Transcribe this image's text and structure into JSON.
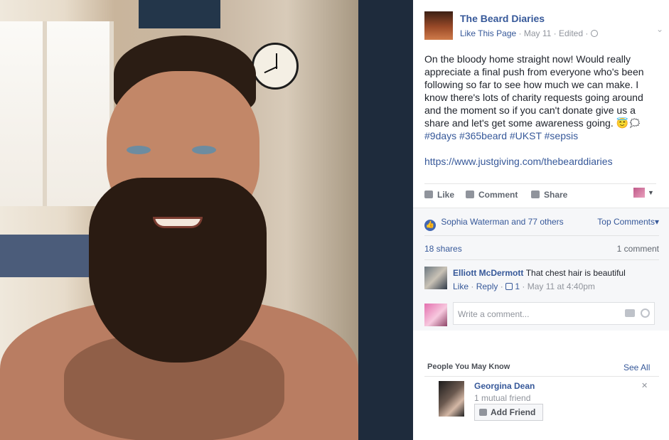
{
  "post": {
    "page_name": "The Beard Diaries",
    "like_page": "Like This Page",
    "meta": "· May 11 · Edited ·",
    "text": "On the bloody home straight now! Would really appreciate a final push from everyone who's been following so far to see how much we can make. I know there's lots of charity requests going around and the moment so if you can't donate give us a share and let's get some awareness going. 😇🗯",
    "hashtags": "#9days #365beard #UKST #sepsis",
    "link": "https://www.justgiving.com/thebearddiaries"
  },
  "actions": {
    "like": "Like",
    "comment": "Comment",
    "share": "Share"
  },
  "stats": {
    "reactions": "Sophia Waterman and 77 others",
    "top_comments": "Top Comments",
    "shares": "18 shares",
    "comments": "1 comment"
  },
  "comment": {
    "author": "Elliott McDermott",
    "text": "That chest hair is beautiful",
    "like": "Like",
    "reply": "Reply",
    "likes_count": "1",
    "time": "· May 11 at 4:40pm"
  },
  "composer": {
    "placeholder": "Write a comment..."
  },
  "pymk": {
    "title": "People You May Know",
    "see_all": "See All",
    "person_name": "Georgina Dean",
    "mutual": "1 mutual friend",
    "add_friend": "Add Friend"
  },
  "colors": {
    "link": "#365899",
    "panel_bg": "#f6f7f9",
    "side_panel": "#1e2b3c"
  }
}
